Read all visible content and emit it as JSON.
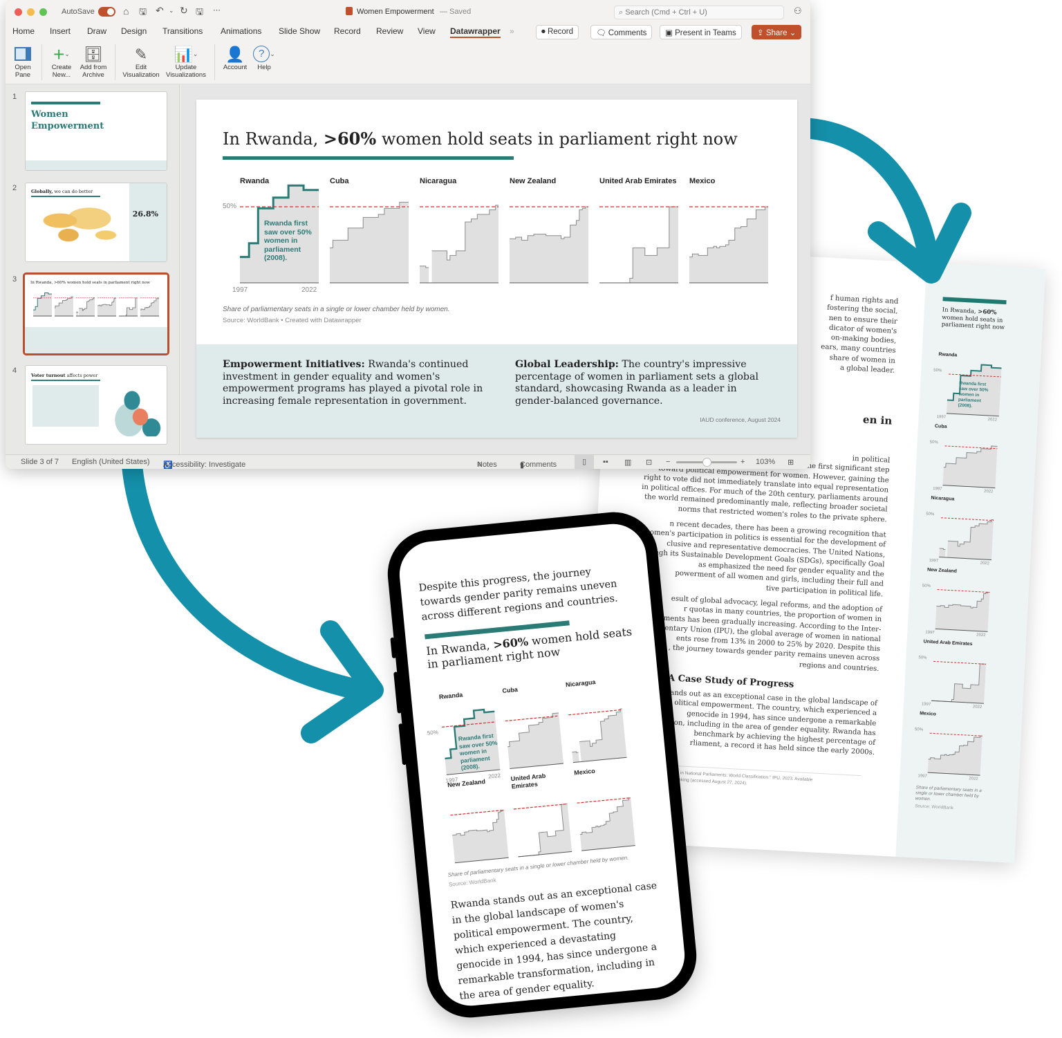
{
  "window": {
    "autosave_label": "AutoSave",
    "doc_title": "Women Empowerment",
    "doc_status": "— Saved",
    "search_placeholder": "Search (Cmd + Ctrl + U)",
    "tabs": [
      "Home",
      "Insert",
      "Draw",
      "Design",
      "Transitions",
      "Animations",
      "Slide Show",
      "Record",
      "Review",
      "View",
      "Datawrapper"
    ],
    "active_tab": "Datawrapper",
    "record_label": "Record",
    "comments_label": "Comments",
    "present_teams_label": "Present in Teams",
    "share_label": "Share",
    "ribbon": [
      {
        "label": "Open Pane",
        "icon": "pane-icon"
      },
      {
        "label": "Create New...",
        "icon": "plus-icon"
      },
      {
        "label": "Add from Archive",
        "icon": "archive-icon"
      },
      {
        "label": "Edit Visualization",
        "icon": "pencil-icon"
      },
      {
        "label": "Update Visualizations",
        "icon": "chart-refresh-icon"
      },
      {
        "label": "Account",
        "icon": "person-icon"
      },
      {
        "label": "Help",
        "icon": "help-icon"
      }
    ],
    "accent": "#c0502b"
  },
  "thumbnails": [
    {
      "num": "1",
      "title": "Women Empowerment"
    },
    {
      "num": "2",
      "title_bold": "Globally,",
      "title_rest": " we can do better",
      "stat": "26.8%"
    },
    {
      "num": "3",
      "title": "In Rwanda, >60% women hold seats in parliament right now"
    },
    {
      "num": "4",
      "title_bold": "Voter turnout",
      "title_rest": " affects power"
    }
  ],
  "slide": {
    "title_pre": "In Rwanda, ",
    "title_bold": ">60%",
    "title_post": " women hold seats in parliament right now",
    "annotation": "Rwanda first saw over 50% women in parliament (2008).",
    "caption": "Share of parliamentary seats in a single or lower chamber held by women.",
    "source": "Source: WorldBank • Created with Datawrapper",
    "box1_bold": "Empowerment Initiatives:",
    "box1_text": " Rwanda's continued investment in gender equality and women's empowerment programs has played a pivotal role in increasing female representation in government.",
    "box2_bold": "Global Leadership:",
    "box2_text": " The country's impressive percentage of women in parliament sets a global standard, showcasing Rwanda as a leader in gender-balanced governance.",
    "footer": "IAUD conference, August 2024"
  },
  "status": {
    "slide_count": "Slide 3 of 7",
    "language": "English (United States)",
    "accessibility": "Accessibility: Investigate",
    "notes": "Notes",
    "comments": "Comments",
    "zoom": "103%",
    "zoom_level": 0.5
  },
  "chart_data": {
    "type": "line",
    "subtype": "small-multiples step area",
    "x_start": "1997",
    "x_end": "2022",
    "reference_line": {
      "value": 50,
      "label": "50%",
      "color": "#d62c2c"
    },
    "ylim": [
      0,
      65
    ],
    "highlight_color": "#2a7a76",
    "series": [
      {
        "name": "Rwanda",
        "values": [
          17,
          17,
          17,
          26,
          26,
          26,
          49,
          49,
          49,
          49,
          49,
          56,
          56,
          56,
          56,
          56,
          64,
          64,
          64,
          64,
          64,
          61,
          61,
          61,
          61,
          61
        ]
      },
      {
        "name": "Cuba",
        "values": [
          23,
          28,
          28,
          28,
          28,
          28,
          36,
          36,
          36,
          36,
          36,
          43,
          43,
          43,
          43,
          43,
          45,
          45,
          49,
          49,
          49,
          49,
          49,
          53,
          53,
          53
        ]
      },
      {
        "name": "Nicaragua",
        "values": [
          11,
          11,
          10,
          null,
          21,
          21,
          21,
          21,
          21,
          15,
          18,
          18,
          21,
          21,
          21,
          40,
          40,
          42,
          42,
          45,
          45,
          45,
          45,
          48,
          48,
          51
        ]
      },
      {
        "name": "New Zealand",
        "values": [
          29,
          29,
          30,
          30,
          28,
          28,
          31,
          31,
          32,
          32,
          32,
          32,
          31,
          31,
          31,
          31,
          31,
          29,
          30,
          30,
          38,
          38,
          41,
          48,
          49,
          50
        ]
      },
      {
        "name": "United Arab Emirates",
        "values": [
          0,
          0,
          0,
          0,
          0,
          0,
          0,
          0,
          0,
          0,
          3,
          23,
          23,
          23,
          23,
          18,
          18,
          18,
          18,
          23,
          23,
          23,
          23,
          50,
          50,
          50
        ]
      },
      {
        "name": "Mexico",
        "values": [
          17,
          19,
          19,
          18,
          18,
          18,
          23,
          23,
          24,
          23,
          24,
          24,
          25,
          28,
          28,
          36,
          36,
          37,
          37,
          42,
          42,
          42,
          48,
          48,
          48,
          50
        ]
      }
    ]
  },
  "document": {
    "para1": [
      "f human rights and",
      "fostering the social,",
      "nen to ensure their",
      "dicator of women's",
      "on-making bodies,",
      "ears, many countries",
      "share of women in",
      "a global leader."
    ],
    "heading1": "en in",
    "para2": [
      "in political",
      "late 19th and early 20th centuries, was the first significant step",
      "toward political empowerment for women. However, gaining the",
      "right to vote did not immediately translate into equal representation",
      "in political offices. For much of the 20th century, parliaments around",
      "the world remained predominantly male, reflecting broader societal",
      "norms that restricted women's roles to the private sphere."
    ],
    "para3": [
      "n recent decades, there has been a growing recognition that",
      "omen's participation in politics is essential for the development of",
      "clusive and representative democracies. The United Nations,",
      "ough its Sustainable Development Goals (SDGs), specifically Goal",
      "as emphasized the need for gender equality and the",
      "powerment of all women and girls, including their full and",
      "tive participation in political life."
    ],
    "para4": [
      "esult of global advocacy, legal reforms, and the adoption of",
      "r quotas in many countries, the proportion of women in",
      "ments has been gradually increasing. According to the Inter-",
      "entary Union (IPU), the global average of women in national",
      "ents rose from 13% in 2000 to 25% by 2020. Despite this",
      ", the journey towards gender parity remains uneven across",
      "regions and countries."
    ],
    "heading2": "a: A Case Study of Progress",
    "para5": [
      "ands out as an exceptional case in the global landscape of",
      "olitical empowerment. The country, which experienced a",
      "genocide in 1994, has since undergone a remarkable",
      "ion, including in the area of gender equality. Rwanda has",
      "benchmark by achieving the highest percentage of",
      "rliament, a record it has held since the early 2000s."
    ],
    "footnote": [
      "ion. \"Women in National Parliaments: World Classification.\" IPU, 2023. Available",
      "rg/women-ranking (accessed August 27, 2024)."
    ],
    "side_title_pre": "In Rwanda, ",
    "side_title_bold": ">60%",
    "side_title_post": " women hold seats in parliament right now",
    "side_caption": "Share of parliamentary seats in a single or lower chamber held by women.",
    "side_source": "Source: WorldBank"
  },
  "phone": {
    "intro": "Despite this progress, the journey towards gender parity remains uneven across different regions and countries.",
    "title_pre": "In Rwanda, ",
    "title_bold": ">60%",
    "title_post": " women hold seats in parliament right now",
    "annotation": "Rwanda first saw over 50% women in parliament (2008).",
    "caption": "Share of parliamentary seats in a single or lower chamber held by women.",
    "source": "Source: WorldBank",
    "body": "Rwanda stands out as an exceptional case in the global landscape of women's political empowerment. The country, which experienced a devastating genocide in 1994, has since undergone a remarkable transformation, including in the area of gender equality."
  },
  "colors": {
    "teal": "#2a7a76",
    "arrow": "#1590aa",
    "share": "#c0502b",
    "box_bg": "#dfeaea"
  }
}
